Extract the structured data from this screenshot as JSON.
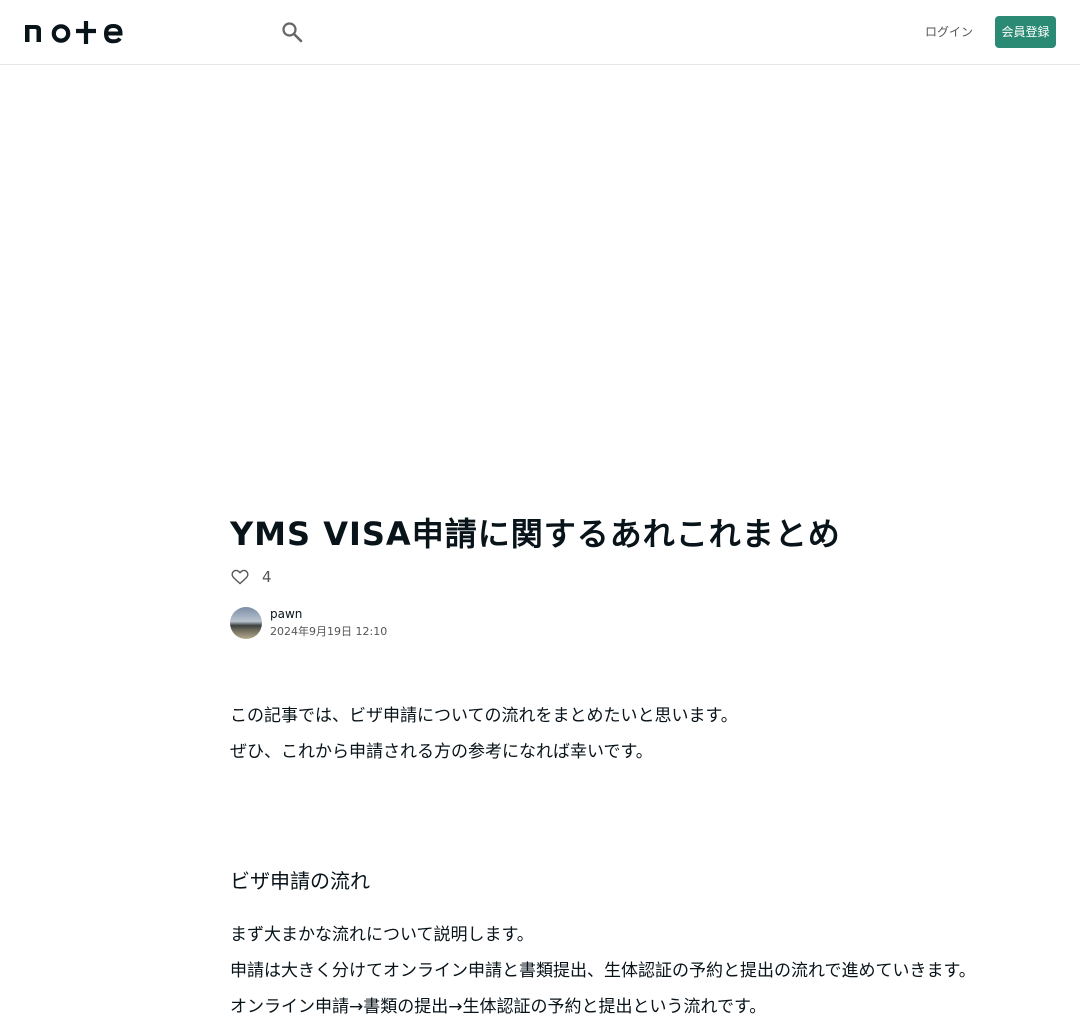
{
  "header": {
    "logo_text": "note",
    "search_icon": "search-icon",
    "login_label": "ログイン",
    "signup_label": "会員登録"
  },
  "article": {
    "title": "YMS VISA申請に関するあれこれまとめ",
    "like_count": "4",
    "author_name": "pawn",
    "published": "2024年9月19日 12:10"
  },
  "body": {
    "intro": [
      "この記事では、ビザ申請についての流れをまとめたいと思います。",
      "ぜひ、これから申請される方の参考になれば幸いです。"
    ],
    "section_heading": "ビザ申請の流れ",
    "section_paragraphs": [
      "まず大まかな流れについて説明します。",
      "申請は大きく分けてオンライン申請と書類提出、生体認証の予約と提出の流れで進めていきます。",
      "オンライン申請→書類の提出→生体認証の予約と提出という流れです。"
    ]
  },
  "colors": {
    "accent": "#2a8a73",
    "text": "#08131a",
    "muted": "#555555"
  }
}
